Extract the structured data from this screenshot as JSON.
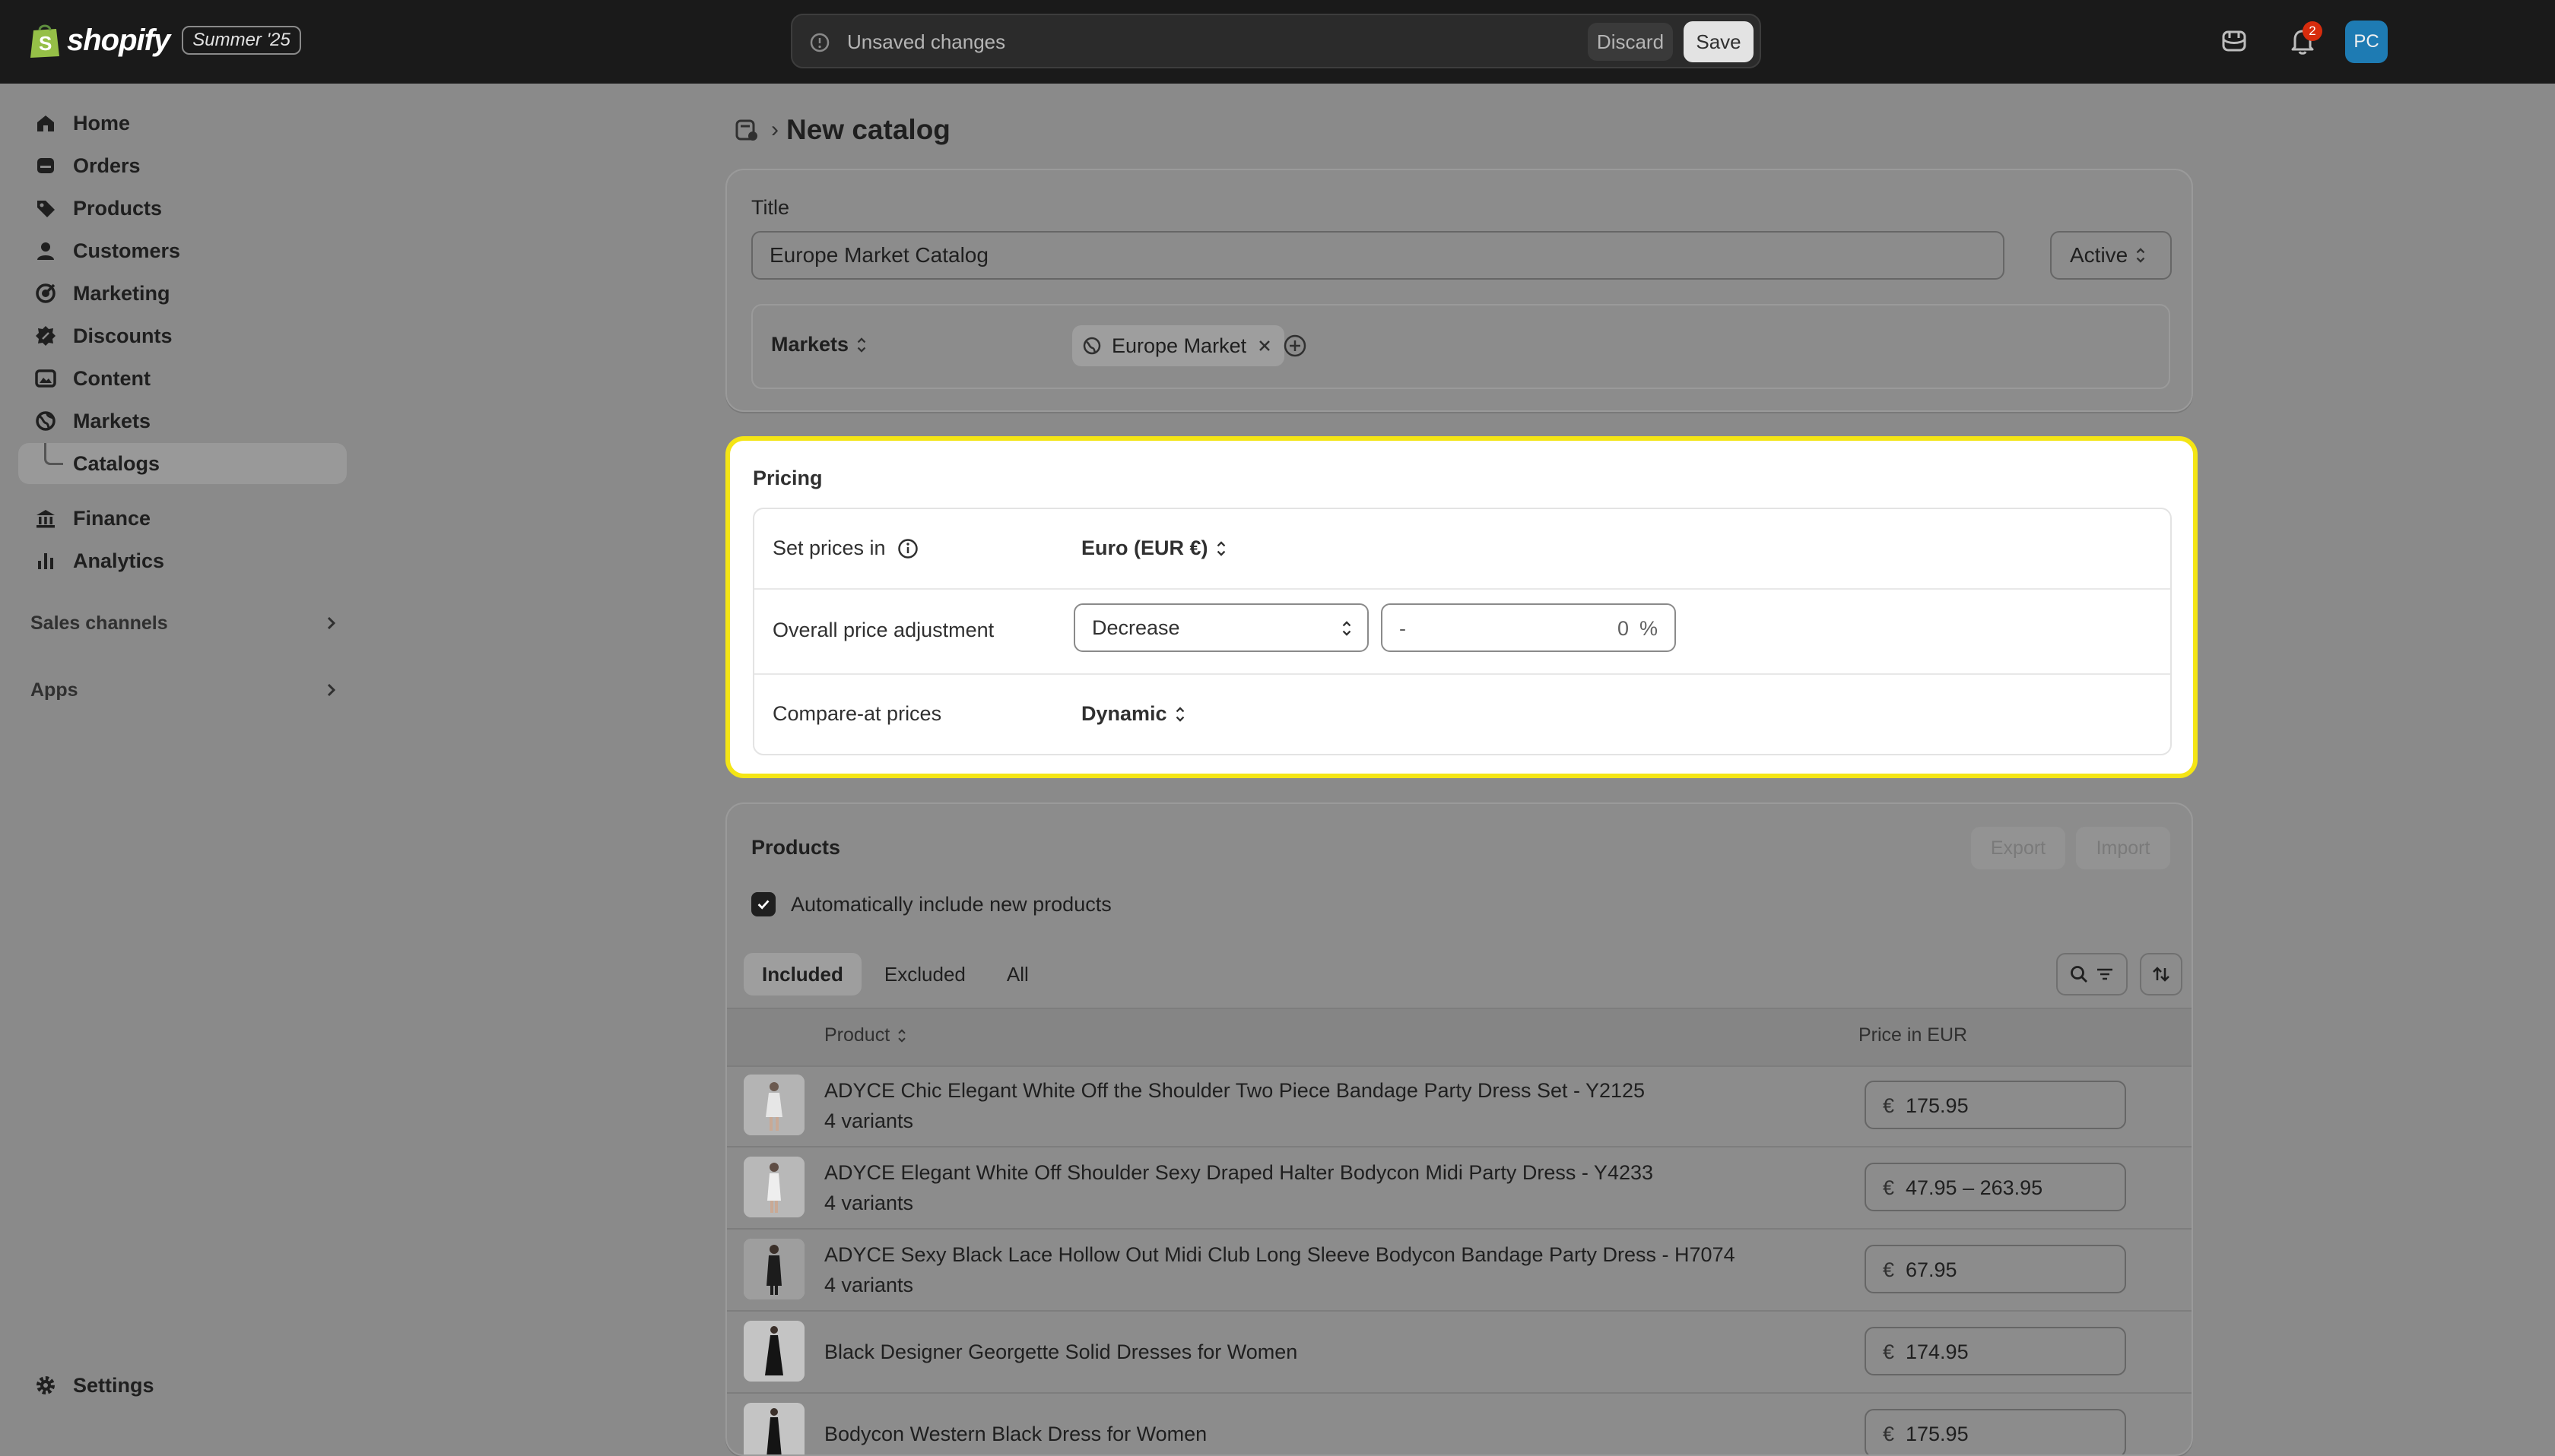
{
  "topbar": {
    "brand": "shopify",
    "edition": "Summer '25",
    "unsaved_text": "Unsaved changes",
    "discard_label": "Discard",
    "save_label": "Save",
    "notification_count": "2",
    "avatar_initials": "PC"
  },
  "sidebar": {
    "items": [
      {
        "label": "Home",
        "icon": "home-icon"
      },
      {
        "label": "Orders",
        "icon": "orders-icon"
      },
      {
        "label": "Products",
        "icon": "tag-icon"
      },
      {
        "label": "Customers",
        "icon": "person-icon"
      },
      {
        "label": "Marketing",
        "icon": "target-icon"
      },
      {
        "label": "Discounts",
        "icon": "discount-icon"
      },
      {
        "label": "Content",
        "icon": "content-icon"
      },
      {
        "label": "Markets",
        "icon": "globe-icon"
      },
      {
        "label": "Catalogs",
        "icon": "",
        "selected": true
      },
      {
        "label": "Finance",
        "icon": "bank-icon"
      },
      {
        "label": "Analytics",
        "icon": "chart-icon"
      }
    ],
    "sales_channels_label": "Sales channels",
    "apps_label": "Apps",
    "settings_label": "Settings"
  },
  "page": {
    "title": "New catalog"
  },
  "title_card": {
    "label": "Title",
    "title_value": "Europe Market Catalog",
    "status": "Active",
    "markets_label": "Markets",
    "market_chip": "Europe Market"
  },
  "pricing": {
    "title": "Pricing",
    "set_prices_label": "Set prices in",
    "currency": "Euro (EUR €)",
    "adjustment_label": "Overall price adjustment",
    "adjustment_direction": "Decrease",
    "adjustment_prefix": "-",
    "adjustment_value": "0",
    "adjustment_suffix": "%",
    "compare_label": "Compare-at prices",
    "compare_value": "Dynamic"
  },
  "products": {
    "title": "Products",
    "export_label": "Export",
    "import_label": "Import",
    "auto_include_label": "Automatically include new products",
    "tabs": [
      "Included",
      "Excluded",
      "All"
    ],
    "col_product": "Product",
    "col_price": "Price in EUR",
    "currency_symbol": "€",
    "rows": [
      {
        "name": "ADYCE Chic Elegant White Off the Shoulder Two Piece Bandage Party Dress Set - Y2125",
        "variants": "4 variants",
        "price": "175.95"
      },
      {
        "name": "ADYCE Elegant White Off Shoulder Sexy Draped Halter Bodycon Midi Party Dress - Y4233",
        "variants": "4 variants",
        "price": "47.95 – 263.95"
      },
      {
        "name": "ADYCE Sexy Black Lace Hollow Out Midi Club Long Sleeve Bodycon Bandage Party Dress - H7074",
        "variants": "4 variants",
        "price": "67.95"
      },
      {
        "name": "Black Designer Georgette Solid Dresses for Women",
        "variants": "",
        "price": "174.95"
      },
      {
        "name": "Bodycon Western Black Dress for Women",
        "variants": "",
        "price": "175.95"
      }
    ]
  },
  "colors": {
    "highlight": "#f4e515",
    "topbar": "#1a1a1a",
    "avatar": "#1e7bb3",
    "badge": "#d72c0d"
  }
}
